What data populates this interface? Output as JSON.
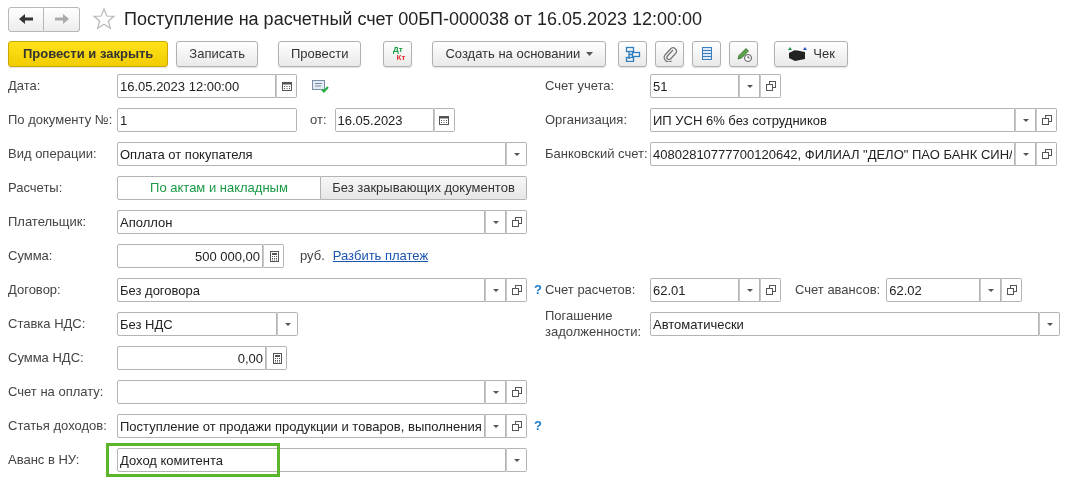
{
  "window": {
    "title": "Поступление на расчетный счет 00БП-000038 от 16.05.2023 12:00:00",
    "favorite": false
  },
  "nav": {
    "back_enabled": true,
    "forward_enabled": false
  },
  "toolbar": [
    {
      "kind": "primary",
      "label": "Провести и закрыть"
    },
    {
      "kind": "button",
      "label": "Записать"
    },
    {
      "kind": "button",
      "label": "Провести"
    },
    {
      "kind": "dtkt",
      "dt": "Дт",
      "kt": "Кт"
    },
    {
      "kind": "menu",
      "label": "Создать на основании"
    },
    {
      "kind": "icon"
    },
    {
      "kind": "icon"
    },
    {
      "kind": "icon"
    },
    {
      "kind": "icon"
    },
    {
      "kind": "printer",
      "label": "Чек"
    }
  ],
  "rows": [
    {
      "left": [
        {
          "kind": "label",
          "text": "Дата:"
        },
        {
          "kind": "field",
          "value": "16.05.2023 12:00:00"
        },
        {
          "kind": "status"
        }
      ],
      "right": [
        {
          "kind": "label",
          "text": "Счет учета:"
        },
        {
          "kind": "field",
          "value": "51"
        }
      ]
    },
    {
      "left": [
        {
          "kind": "label",
          "text": "По документу №:"
        },
        {
          "kind": "field",
          "value": "1"
        },
        {
          "kind": "label",
          "text": "от:"
        },
        {
          "kind": "field",
          "value": "16.05.2023"
        }
      ],
      "right": [
        {
          "kind": "label",
          "text": "Организация:"
        },
        {
          "kind": "field",
          "value": "ИП УСН 6% без сотрудников"
        }
      ]
    },
    {
      "left": [
        {
          "kind": "label",
          "text": "Вид операции:"
        },
        {
          "kind": "field",
          "value": "Оплата от покупателя"
        }
      ],
      "right": [
        {
          "kind": "label",
          "text": "Банковский счет:"
        },
        {
          "kind": "field",
          "value": "40802810777700120642, ФИЛИАЛ \"ДЕЛО\" ПАО БАНК СИН/"
        }
      ]
    },
    {
      "left": [
        {
          "kind": "label",
          "text": "Расчеты:"
        },
        {
          "kind": "toggle",
          "options": [
            {
              "label": "По актам и накладным",
              "selected": true
            },
            {
              "label": "Без закрывающих документов",
              "selected": false
            }
          ]
        }
      ]
    },
    {
      "left": [
        {
          "kind": "label",
          "text": "Плательщик:"
        },
        {
          "kind": "field",
          "value": "Аполлон"
        }
      ]
    },
    {
      "left": [
        {
          "kind": "label",
          "text": "Сумма:"
        },
        {
          "kind": "field",
          "value": "500 000,00"
        },
        {
          "kind": "label",
          "text": "руб."
        },
        {
          "kind": "link",
          "text": "Разбить платеж"
        }
      ]
    },
    {
      "left": [
        {
          "kind": "label",
          "text": "Договор:"
        },
        {
          "kind": "field",
          "value": "Без договора"
        },
        {
          "kind": "help",
          "text": "?"
        }
      ],
      "right": [
        {
          "kind": "label",
          "text": "Счет расчетов:"
        },
        {
          "kind": "field",
          "value": "62.01"
        },
        {
          "kind": "label",
          "text": "Счет авансов:"
        },
        {
          "kind": "field",
          "value": "62.02"
        }
      ]
    },
    {
      "left": [
        {
          "kind": "label",
          "text": "Ставка НДС:"
        },
        {
          "kind": "field",
          "value": "Без НДС"
        }
      ],
      "right": [
        {
          "kind": "label",
          "text": "Погашение задолженности:"
        },
        {
          "kind": "field",
          "value": "Автоматически"
        }
      ]
    },
    {
      "left": [
        {
          "kind": "label",
          "text": "Сумма НДС:"
        },
        {
          "kind": "field",
          "value": "0,00"
        }
      ]
    },
    {
      "left": [
        {
          "kind": "label",
          "text": "Счет на оплату:"
        },
        {
          "kind": "field"
        }
      ]
    },
    {
      "left": [
        {
          "kind": "label",
          "text": "Статья доходов:"
        },
        {
          "kind": "field",
          "value": "Поступление от продажи продукции и товаров, выполнения"
        },
        {
          "kind": "help",
          "text": "?"
        }
      ]
    },
    {
      "left": [
        {
          "kind": "label",
          "text": "Аванс в НУ:"
        },
        {
          "kind": "field",
          "value": "Доход комитента",
          "highlighted": true
        }
      ]
    }
  ]
}
